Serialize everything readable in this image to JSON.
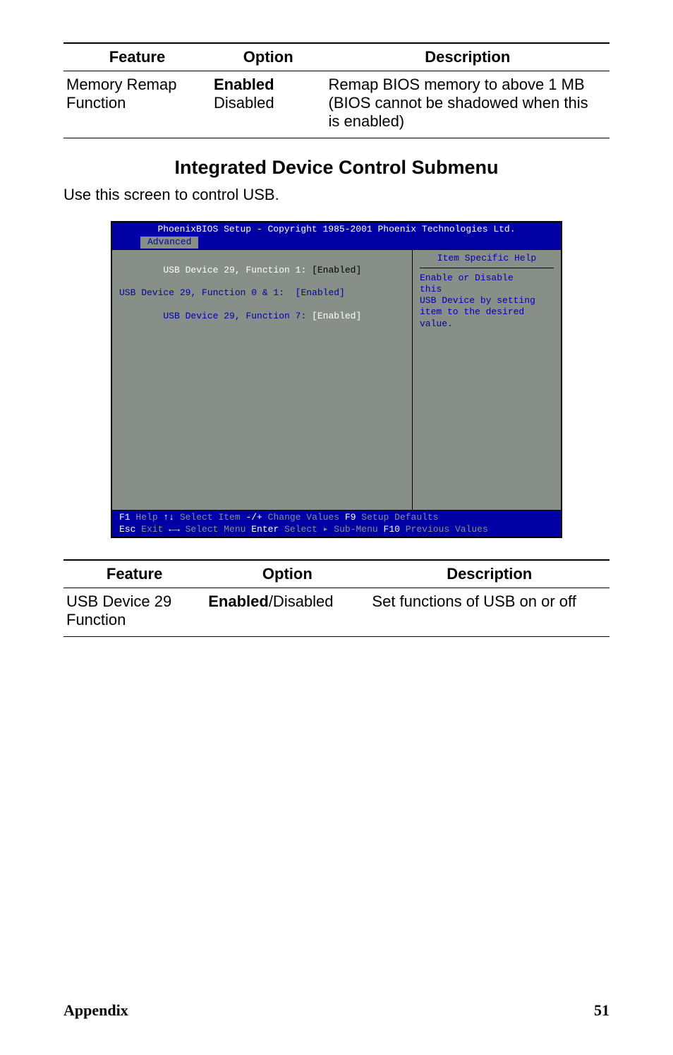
{
  "table1": {
    "headers": {
      "feature": "Feature",
      "option": "Option",
      "description": "Description"
    },
    "row": {
      "feature_l1": "Memory Remap",
      "feature_l2": "Function",
      "opt_bold": "Enabled",
      "opt_plain": "Disabled",
      "desc_l1": "Remap BIOS memory to above 1 MB",
      "desc_l2": "(BIOS cannot be shadowed when this",
      "desc_l3": "is enabled)"
    }
  },
  "section_title": "Integrated Device Control Submenu",
  "sub_caption": "Use this screen to control USB.",
  "bios": {
    "title": "PhoenixBIOS Setup - Copyright 1985-2001 Phoenix Technologies Ltd.",
    "tab": "Advanced",
    "left": {
      "l1_pre": "USB Device 29, Function 1: ",
      "l1_val": "[Enabled]",
      "l2": "USB Device 29, Function 0 & 1:  [Enabled]",
      "l3_pre": "USB Device 29, Function 7: ",
      "l3_val": "[Enabled]"
    },
    "right": {
      "title": "Item Specific Help",
      "h1": "Enable or Disable",
      "h2": "this",
      "h3": "USB Device by setting",
      "h4": "item to the desired",
      "h5": "value."
    },
    "footer": {
      "f1a": "F1",
      "f1b": " Help  ",
      "f2a": "↑↓",
      "f2b": " Select Item  ",
      "f3a": "-/+",
      "f3b": "  Change Values    ",
      "f4a": "F9",
      "f4b": "  Setup Defaults",
      "g1a": "Esc",
      "g1b": " Exit  ",
      "g2a": "←→",
      "g2b": " Select Menu  ",
      "g3a": "Enter",
      "g3b": " Select ▸ Sub-Menu",
      "g4a": "F10",
      "g4b": " Previous Values"
    }
  },
  "table2": {
    "headers": {
      "feature": "Feature",
      "option": "Option",
      "description": "Description"
    },
    "row": {
      "feature_l1": "USB Device 29",
      "feature_l2": "Function",
      "opt_bold": "Enabled",
      "opt_plain": "/Disabled",
      "desc": "Set functions of USB on or off"
    }
  },
  "footer": {
    "appendix": "Appendix",
    "page": "51"
  },
  "chart_data": {
    "type": "table",
    "tables": [
      {
        "title": "Memory Remap Function",
        "columns": [
          "Feature",
          "Option",
          "Description"
        ],
        "rows": [
          [
            "Memory Remap Function",
            "Enabled (default) / Disabled",
            "Remap BIOS memory to above 1 MB (BIOS cannot be shadowed when this is enabled)"
          ]
        ]
      },
      {
        "title": "Integrated Device Control Submenu",
        "columns": [
          "Feature",
          "Option",
          "Description"
        ],
        "rows": [
          [
            "USB Device 29 Function",
            "Enabled (default) / Disabled",
            "Set functions of USB on or off"
          ]
        ]
      }
    ],
    "bios_items": [
      {
        "item": "USB Device 29, Function 1",
        "value": "Enabled"
      },
      {
        "item": "USB Device 29, Function 0 & 1",
        "value": "Enabled"
      },
      {
        "item": "USB Device 29, Function 7",
        "value": "Enabled"
      }
    ]
  }
}
